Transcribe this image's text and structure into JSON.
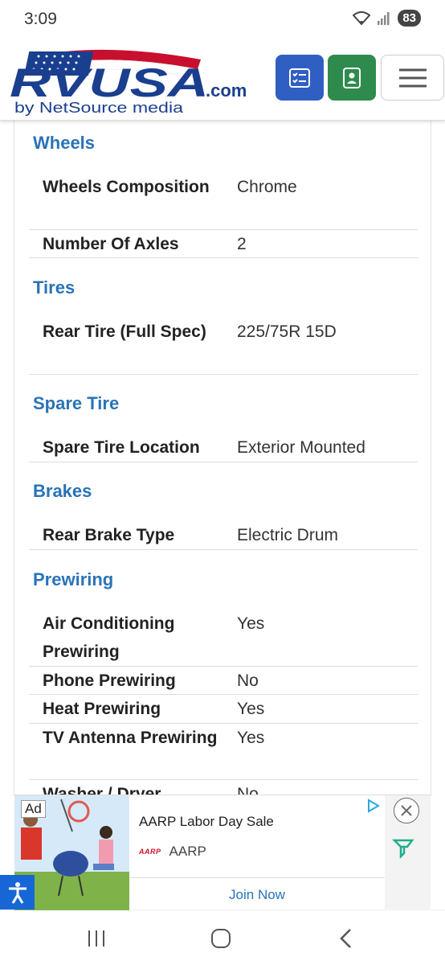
{
  "status_bar": {
    "time": "3:09",
    "battery": "83"
  },
  "header": {
    "logo_text": "RVUSA",
    "logo_domain": ".com",
    "logo_tagline": "by NetSource media"
  },
  "sections": {
    "wheels": {
      "title": "Wheels",
      "rows": [
        {
          "label": "Wheels Composition",
          "value": "Chrome"
        },
        {
          "label": "Number Of Axles",
          "value": "2"
        }
      ]
    },
    "tires": {
      "title": "Tires",
      "rows": [
        {
          "label": "Rear Tire (Full Spec)",
          "value": "225/75R 15D"
        }
      ]
    },
    "spare_tire": {
      "title": "Spare Tire",
      "rows": [
        {
          "label": "Spare Tire Location",
          "value": "Exterior Mounted"
        }
      ]
    },
    "brakes": {
      "title": "Brakes",
      "rows": [
        {
          "label": "Rear Brake Type",
          "value": "Electric Drum"
        }
      ]
    },
    "prewiring": {
      "title": "Prewiring",
      "rows": [
        {
          "label": "Air Conditioning Prewiring",
          "value": "Yes"
        },
        {
          "label": "Phone Prewiring",
          "value": "No"
        },
        {
          "label": "Heat Prewiring",
          "value": "Yes"
        },
        {
          "label": "TV Antenna Prewiring",
          "value": "Yes"
        },
        {
          "label": "Washer / Dryer",
          "value": "No"
        }
      ]
    }
  },
  "ad": {
    "badge": "Ad",
    "title": "AARP Labor Day Sale",
    "brand_logo": "AARP",
    "brand": "AARP",
    "cta": "Join Now"
  },
  "colors": {
    "section_title": "#2a73b7",
    "list_button": "#2f5fc3",
    "contact_button": "#2e8b4d",
    "accessibility_button": "#1766d6"
  }
}
